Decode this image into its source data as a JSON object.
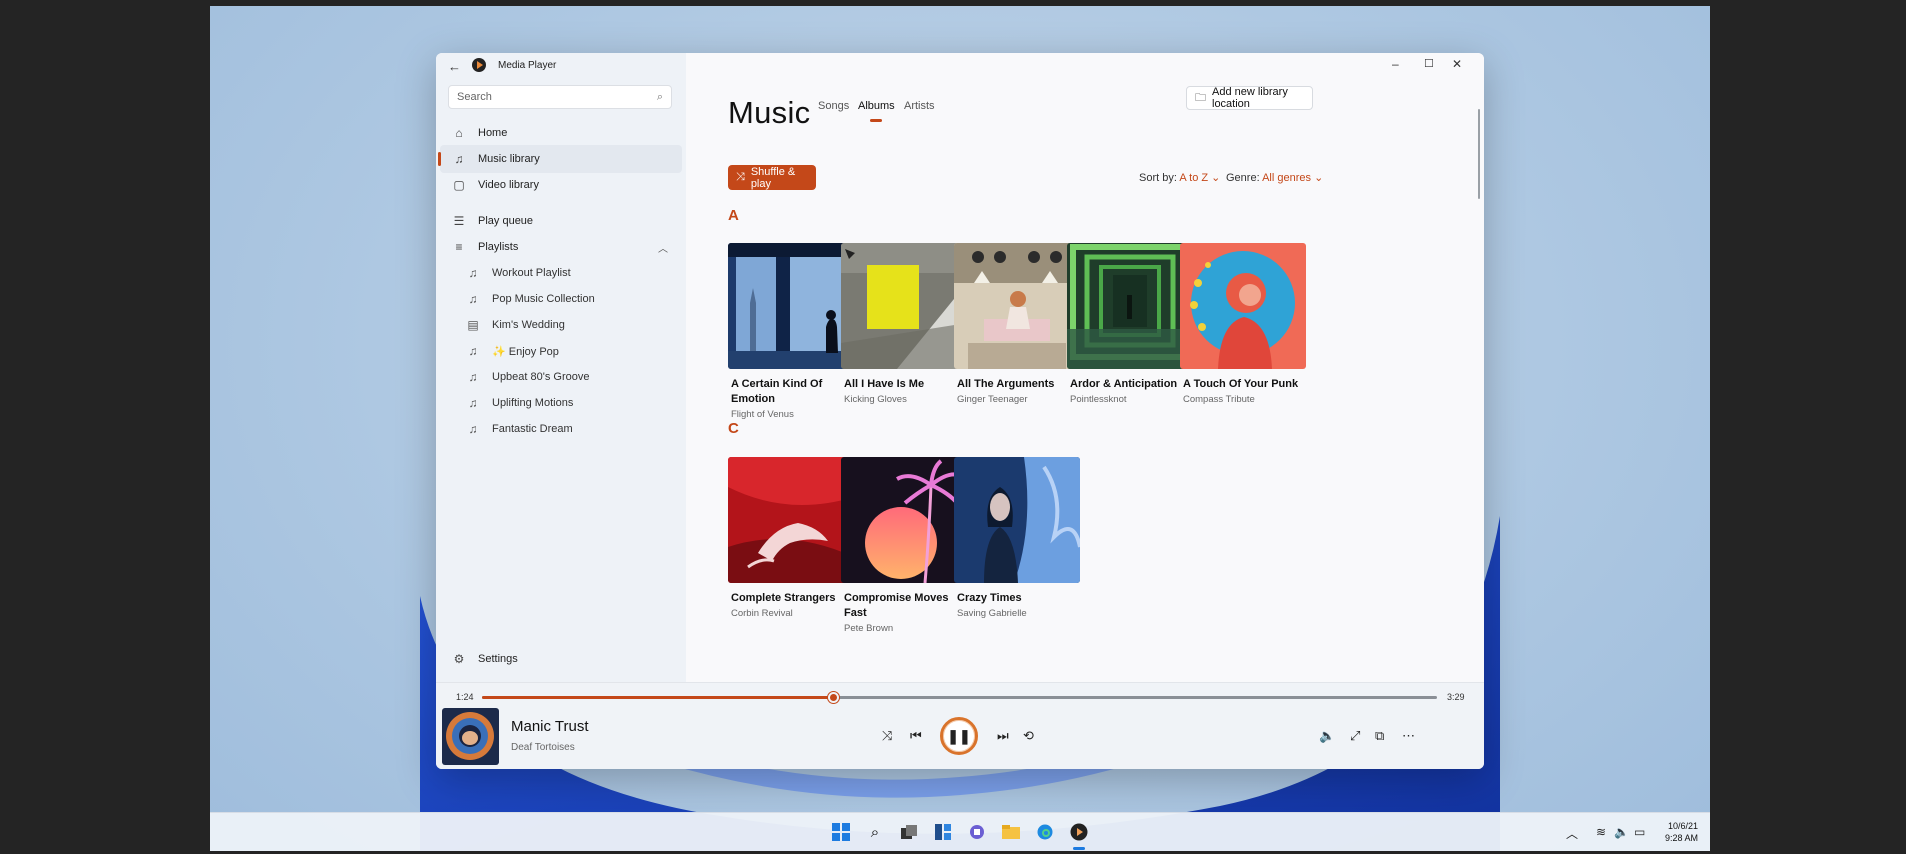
{
  "app": {
    "back_icon": "back-arrow-icon",
    "title": "Media Player"
  },
  "window_controls": {
    "minimize": "–",
    "maximize": "☐",
    "close": "✕"
  },
  "sidebar": {
    "search_placeholder": "Search",
    "nav": [
      {
        "label": "Home",
        "icon": "home-icon"
      },
      {
        "label": "Music library",
        "icon": "music-note-icon",
        "active": true
      },
      {
        "label": "Video library",
        "icon": "video-icon"
      },
      {
        "label": "Play queue",
        "icon": "queue-icon"
      },
      {
        "label": "Playlists",
        "icon": "playlists-icon"
      }
    ],
    "playlists": [
      {
        "label": "Workout Playlist"
      },
      {
        "label": "Pop Music Collection"
      },
      {
        "label": "Kim's Wedding"
      },
      {
        "label": "✨ Enjoy Pop"
      },
      {
        "label": "Upbeat 80's Groove"
      },
      {
        "label": "Uplifting Motions"
      },
      {
        "label": "Fantastic Dream"
      }
    ],
    "settings_label": "Settings"
  },
  "main": {
    "heading": "Music",
    "tabs": [
      {
        "label": "Songs"
      },
      {
        "label": "Albums",
        "selected": true
      },
      {
        "label": "Artists"
      }
    ],
    "add_library_label": "Add new library location",
    "shuffle_label": "Shuffle & play",
    "sort_label": "Sort by:",
    "sort_value": "A to Z",
    "genre_label": "Genre:",
    "genre_value": "All genres",
    "sections": [
      {
        "letter": "A",
        "albums": [
          {
            "title": "A Certain Kind Of Emotion",
            "artist": "Flight of Venus"
          },
          {
            "title": "All I Have Is Me",
            "artist": "Kicking Gloves"
          },
          {
            "title": "All The Arguments",
            "artist": "Ginger Teenager"
          },
          {
            "title": "Ardor & Anticipation",
            "artist": "Pointlessknot"
          },
          {
            "title": "A Touch Of Your Punk",
            "artist": "Compass Tribute"
          }
        ]
      },
      {
        "letter": "C",
        "albums": [
          {
            "title": "Complete Strangers",
            "artist": "Corbin Revival"
          },
          {
            "title": "Compromise Moves Fast",
            "artist": "Pete Brown"
          },
          {
            "title": "Crazy Times",
            "artist": "Saving Gabrielle"
          }
        ]
      }
    ]
  },
  "player": {
    "elapsed": "1:24",
    "duration": "3:29",
    "progress_fraction": 0.368,
    "track_title": "Manic Trust",
    "track_artist": "Deaf Tortoises",
    "controls": [
      "shuffle-icon",
      "previous-icon",
      "pause-icon",
      "next-icon",
      "repeat-icon"
    ],
    "right_controls": [
      "volume-icon",
      "fullscreen-icon",
      "miniplayer-icon",
      "more-icon"
    ]
  },
  "taskbar": {
    "date": "10/6/21",
    "time": "9:28 AM"
  },
  "colors": {
    "accent": "#c44819",
    "sidebar_bg": "#eef2f7"
  }
}
